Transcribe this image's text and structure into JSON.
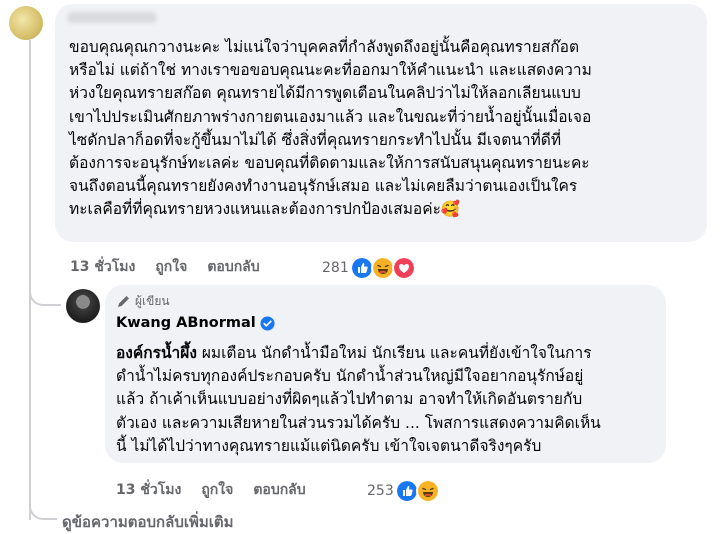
{
  "main_comment": {
    "author": "",
    "text": "ขอบคุณคุณกวางนะคะ ไม่แน่ใจว่าบุคคลที่กำลังพูดถึงอยู่นั้นคือคุณทรายสก๊อต\nหรือไม่ แต่ถ้าใช่ ทางเราขอขอบคุณนะคะที่ออกมาให้คำแนะนำ และแสดงความ\nห่วงใยคุณทรายสก๊อต คุณทรายได้มีการพูดเตือนในคลิปว่าไม่ให้ลอกเลียนแบบ\nเขาไปประเมินศักยภาพร่างกายตนเองมาแล้ว และในขณะที่ว่ายน้ำอยู่นั้นเมื่อเจอ\nไซดักปลาก็อดที่จะกู้ขึ้นมาไม่ได้ ซึ่งสิ่งที่คุณทรายกระทำไปนั้น มีเจตนาที่ดีที่\nต้องการจะอนุรักษ์ทะเลค่ะ ขอบคุณที่ติดตามและให้การสนับสนุนคุณทรายนะคะ\nจนถึงตอนนี้คุณทรายยังคงทำงานอนุรักษ์เสมอ และไม่เคยลืมว่าตนเองเป็นใคร\nทะเลคือที่ที่คุณทรายหวงแหนและต้องการปกป้องเสมอค่ะ🥰",
    "time": "13 ชั่วโมง",
    "like": "ถูกใจ",
    "reply": "ตอบกลับ",
    "reaction_count": "281",
    "reaction_icons": [
      "like-icon",
      "haha-icon",
      "love-icon"
    ]
  },
  "reply_comment": {
    "badge": "ผู้เขียน",
    "author": "Kwang ABnormal",
    "mention": "องค์กรน้ำผึ้ง",
    "text": " ผมเตือน นักดำน้ำมือใหม่ นักเรียน และคนที่ยังเข้าใจในการ\nดำน้ำไม่ครบทุกองค์ประกอบครับ นักดำน้ำส่วนใหญ่มีใจอยากอนุรักษ์อยู่\nแล้ว ถ้าเค้าเห็นแบบอย่างที่ผิดๆแล้วไปทำตาม อาจทำให้เกิดอันตรายกับ\nตัวเอง และความเสียหายในส่วนรวมได้ครับ ... โพสการแสดงความคิดเห็น\nนี้ ไม่ได้ไปว่าทางคุณทรายแม้แต่นิดครับ เข้าใจเจตนาดีจริงๆครับ",
    "time": "13 ชั่วโมง",
    "like": "ถูกใจ",
    "reply": "ตอบกลับ",
    "reaction_count": "253",
    "reaction_icons": [
      "like-icon",
      "haha-icon"
    ]
  },
  "more_replies": "ดูข้อความตอบกลับเพิ่มเติม",
  "colors": {
    "bubble": "#f0f2f5",
    "muted": "#65676b",
    "like_blue": "#1877f2",
    "love_red": "#f33e58",
    "haha_yellow": "#f7b125"
  }
}
